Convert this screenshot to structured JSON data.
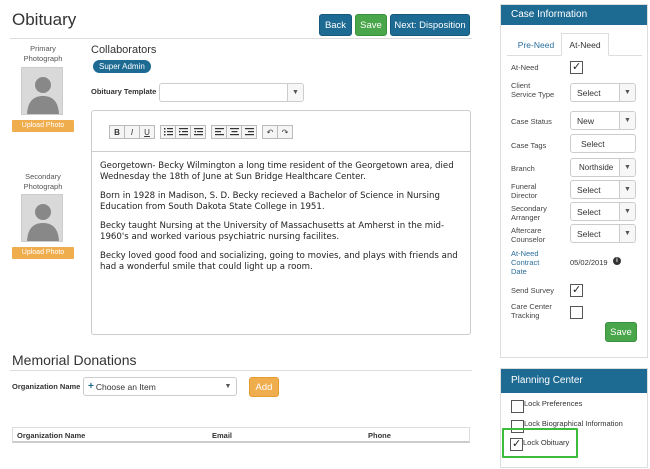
{
  "header": {
    "title": "Obituary",
    "back_label": "Back",
    "save_label": "Save",
    "next_label": "Next: Disposition"
  },
  "photos": {
    "primary_label": "Primary Photograph",
    "secondary_label": "Secondary Photograph",
    "upload_label": "Upload Photo"
  },
  "collaborators": {
    "title": "Collaborators",
    "badge": "Super Admin"
  },
  "template": {
    "label": "Obituary Template",
    "value": ""
  },
  "editor": {
    "toolbar": [
      "B",
      "I",
      "U",
      "list-icon",
      "outdent-icon",
      "indent-icon",
      "align-left-icon",
      "align-center-icon",
      "align-right-icon",
      "undo-icon",
      "redo-icon"
    ],
    "paragraphs": [
      "Georgetown- Becky Wilmington a long time resident of the Georgetown area, died Wednesday the 18th of June at Sun Bridge Healthcare Center.",
      "Born in 1928 in Madison, S. D. Becky recieved a Bachelor of Science in Nursing Education from South Dakota State College in 1951.",
      "Becky taught Nursing at the University of Massachusetts at Amherst in the mid-1960's and worked various psychiatric nursing facilites.",
      "Becky loved good food and socializing, going to movies, and plays with friends and had a wonderful smile that could light up a room."
    ]
  },
  "donations": {
    "title": "Memorial Donations",
    "org_label": "Organization Name",
    "org_placeholder": "Choose an Item",
    "add_label": "Add",
    "columns": [
      "Organization Name",
      "Email",
      "Phone"
    ]
  },
  "case_info": {
    "title": "Case Information",
    "tabs": [
      "Pre-Need",
      "At-Need"
    ],
    "active_tab": "At-Need",
    "fields": {
      "at_need": "At-Need",
      "client_service_type": "Client Service Type",
      "client_service_value": "Select",
      "case_status": "Case Status",
      "case_status_value": "New",
      "case_tags": "Case Tags",
      "case_tags_value": "Select",
      "branch": "Branch",
      "branch_value": "Northside",
      "funeral_director": "Funeral Director",
      "funeral_director_value": "Select",
      "secondary_arranger": "Secondary Arranger",
      "secondary_arranger_value": "Select",
      "aftercare_counselor": "Aftercare Counselor",
      "aftercare_counselor_value": "Select",
      "at_need_contract_date": "At-Need Contract Date",
      "at_need_contract_date_value": "05/02/2019",
      "send_survey": "Send Survey",
      "care_center_tracking": "Care Center Tracking"
    },
    "save_label": "Save"
  },
  "planning_center": {
    "title": "Planning Center",
    "items": [
      {
        "label": "Lock Preferences",
        "checked": false
      },
      {
        "label": "Lock Biographical Information",
        "checked": false
      },
      {
        "label": "Lock Obituary",
        "checked": true
      }
    ]
  },
  "colors": {
    "primary": "#1d6a93",
    "success": "#4aa64a",
    "warning": "#f0ad4e",
    "highlight": "#3dbb3d"
  }
}
